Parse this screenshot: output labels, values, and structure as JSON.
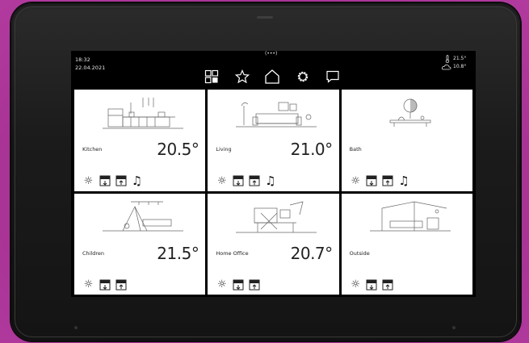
{
  "status": {
    "time": "18:32",
    "date": "22.04.2021",
    "indoor_temp": "21.5°",
    "outdoor_temp": "10.8°"
  },
  "nav": {
    "icons": [
      "grid-icon",
      "star-icon",
      "home-icon",
      "settings-icon",
      "chat-icon"
    ],
    "active": "home-icon"
  },
  "rooms": [
    {
      "name": "Kitchen",
      "temp": "20.5°",
      "controls": [
        "light-icon",
        "blind-down-icon",
        "blind-up-icon",
        "music-icon"
      ]
    },
    {
      "name": "Living",
      "temp": "21.0°",
      "controls": [
        "light-icon",
        "blind-down-icon",
        "blind-up-icon",
        "music-icon"
      ]
    },
    {
      "name": "Bath",
      "temp": "",
      "controls": [
        "light-icon",
        "blind-down-icon",
        "blind-up-icon",
        "music-icon"
      ]
    },
    {
      "name": "Children",
      "temp": "21.5°",
      "controls": [
        "light-icon",
        "blind-down-icon",
        "blind-up-icon"
      ]
    },
    {
      "name": "Home Office",
      "temp": "20.7°",
      "controls": [
        "light-icon",
        "blind-down-icon",
        "blind-up-icon"
      ]
    },
    {
      "name": "Outside",
      "temp": "",
      "controls": [
        "light-icon",
        "blind-down-icon",
        "blind-up-icon"
      ]
    }
  ],
  "colors": {
    "frame": "#1b1b1b",
    "background": "#a53293",
    "screen": "#000000",
    "tile": "#ffffff"
  }
}
